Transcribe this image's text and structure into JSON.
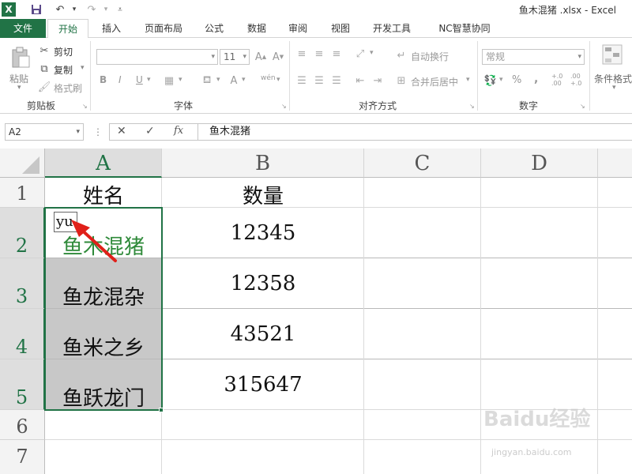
{
  "titlebar": {
    "app_icon": "X",
    "title": "鱼木混猪 .xlsx - Excel"
  },
  "tabs": [
    "文件",
    "开始",
    "插入",
    "页面布局",
    "公式",
    "数据",
    "审阅",
    "视图",
    "开发工具",
    "NC智慧协同"
  ],
  "ribbon": {
    "clipboard": {
      "paste": "粘贴",
      "cut": "剪切",
      "copy": "复制",
      "format_painter": "格式刷",
      "label": "剪贴板"
    },
    "font": {
      "size": "11",
      "bold": "B",
      "italic": "I",
      "underline": "U",
      "phonetic": "wén",
      "label": "字体"
    },
    "alignment": {
      "wrap_text": "自动换行",
      "merge_center": "合并后居中",
      "label": "对齐方式"
    },
    "number": {
      "format": "常规",
      "percent": "%",
      "comma": ",",
      "inc_decimal": "+.0 .00",
      "dec_decimal": ".00 +.0",
      "label": "数字"
    },
    "styles": {
      "conditional_format": "条件格式"
    }
  },
  "formula_bar": {
    "name_box": "A2",
    "cancel": "✕",
    "enter": "✓",
    "fx": "fx",
    "content": "鱼木混猪"
  },
  "sheet": {
    "columns": [
      "A",
      "B",
      "C",
      "D"
    ],
    "rows": [
      "1",
      "2",
      "3",
      "4",
      "5",
      "6",
      "7"
    ],
    "header_row": {
      "a": "姓名",
      "b": "数量"
    },
    "data": [
      {
        "a": "鱼木混猪",
        "b": "12345"
      },
      {
        "a": "鱼龙混杂",
        "b": "12358"
      },
      {
        "a": "鱼米之乡",
        "b": "43521"
      },
      {
        "a": "鱼跃龙门",
        "b": "315647"
      }
    ],
    "ime_text": "yu"
  },
  "watermark": {
    "brand": "Baidu经验",
    "url": "jingyan.baidu.com"
  },
  "colors": {
    "excel_green": "#217346",
    "selection_gray": "#c8c8c8",
    "annotation_red": "#e0201a"
  }
}
